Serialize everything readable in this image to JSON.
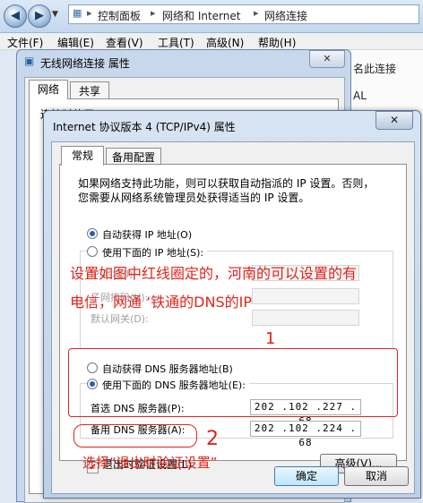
{
  "explorer": {
    "breadcrumbs": [
      "控制面板",
      "网络和 Internet",
      "网络连接"
    ],
    "menu": [
      "文件(F)",
      "编辑(E)",
      "查看(V)",
      "工具(T)",
      "高级(N)",
      "帮助(H)"
    ],
    "right_pane": {
      "label_top": "名此连接",
      "label_mid": "AL"
    }
  },
  "wireless_dialog": {
    "title": "无线网络连接 属性",
    "tabs": [
      "网络",
      "共享"
    ],
    "partial_text": "连接时使用"
  },
  "ipv4_dialog": {
    "title": "Internet 协议版本 4 (TCP/IPv4) 属性",
    "tabs": [
      "常规",
      "备用配置"
    ],
    "description_line1": "如果网络支持此功能，则可以获取自动指派的 IP 设置。否则，",
    "description_line2": "您需要从网络系统管理员处获得适当的 IP 设置。",
    "ip_auto_label": "自动获得 IP 地址(O)",
    "ip_manual_label": "使用下面的 IP 地址(S):",
    "ip_address_label": "IP 地址(I):",
    "subnet_label": "子网掩码(U):",
    "gateway_label": "默认网关(D):",
    "dns_auto_label": "自动获得 DNS 服务器地址(B)",
    "dns_manual_label": "使用下面的 DNS 服务器地址(E):",
    "preferred_dns_label": "首选 DNS 服务器(P):",
    "preferred_dns_value": "202 .102 .227 . 68",
    "alternate_dns_label": "备用 DNS 服务器(A):",
    "alternate_dns_value": "202 .102 .224 . 68",
    "validate_label": "退出时验证设置(L)",
    "advanced_button": "高级(V)...",
    "ok_button": "确定",
    "cancel_button": "取消"
  },
  "annotations": {
    "note_line1": "设置如图中红线圈定的，河南的可以设置的有",
    "note_line2": "电信，网通 ‘铁通的DNS的IP",
    "marker1": "1",
    "marker2": "2",
    "note_validate": "选择“退出时验证设置”"
  },
  "colors": {
    "annotation": "#e2231a",
    "title_gradient": "#d7e4f3"
  }
}
